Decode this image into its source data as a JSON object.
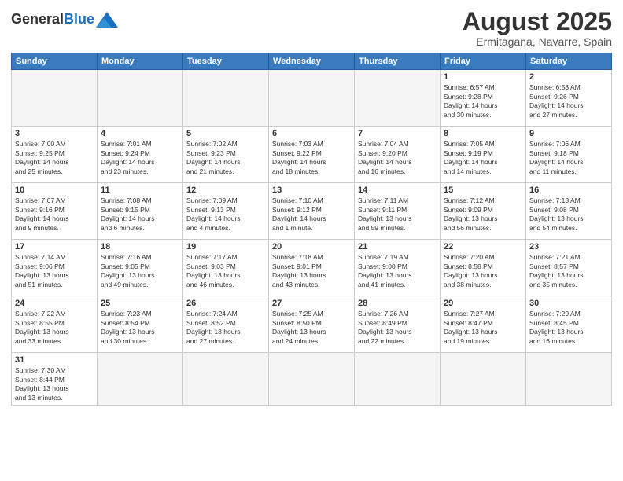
{
  "header": {
    "logo_general": "General",
    "logo_blue": "Blue",
    "title": "August 2025",
    "subtitle": "Ermitagana, Navarre, Spain"
  },
  "days_of_week": [
    "Sunday",
    "Monday",
    "Tuesday",
    "Wednesday",
    "Thursday",
    "Friday",
    "Saturday"
  ],
  "weeks": [
    [
      {
        "day": "",
        "info": ""
      },
      {
        "day": "",
        "info": ""
      },
      {
        "day": "",
        "info": ""
      },
      {
        "day": "",
        "info": ""
      },
      {
        "day": "",
        "info": ""
      },
      {
        "day": "1",
        "info": "Sunrise: 6:57 AM\nSunset: 9:28 PM\nDaylight: 14 hours\nand 30 minutes."
      },
      {
        "day": "2",
        "info": "Sunrise: 6:58 AM\nSunset: 9:26 PM\nDaylight: 14 hours\nand 27 minutes."
      }
    ],
    [
      {
        "day": "3",
        "info": "Sunrise: 7:00 AM\nSunset: 9:25 PM\nDaylight: 14 hours\nand 25 minutes."
      },
      {
        "day": "4",
        "info": "Sunrise: 7:01 AM\nSunset: 9:24 PM\nDaylight: 14 hours\nand 23 minutes."
      },
      {
        "day": "5",
        "info": "Sunrise: 7:02 AM\nSunset: 9:23 PM\nDaylight: 14 hours\nand 21 minutes."
      },
      {
        "day": "6",
        "info": "Sunrise: 7:03 AM\nSunset: 9:22 PM\nDaylight: 14 hours\nand 18 minutes."
      },
      {
        "day": "7",
        "info": "Sunrise: 7:04 AM\nSunset: 9:20 PM\nDaylight: 14 hours\nand 16 minutes."
      },
      {
        "day": "8",
        "info": "Sunrise: 7:05 AM\nSunset: 9:19 PM\nDaylight: 14 hours\nand 14 minutes."
      },
      {
        "day": "9",
        "info": "Sunrise: 7:06 AM\nSunset: 9:18 PM\nDaylight: 14 hours\nand 11 minutes."
      }
    ],
    [
      {
        "day": "10",
        "info": "Sunrise: 7:07 AM\nSunset: 9:16 PM\nDaylight: 14 hours\nand 9 minutes."
      },
      {
        "day": "11",
        "info": "Sunrise: 7:08 AM\nSunset: 9:15 PM\nDaylight: 14 hours\nand 6 minutes."
      },
      {
        "day": "12",
        "info": "Sunrise: 7:09 AM\nSunset: 9:13 PM\nDaylight: 14 hours\nand 4 minutes."
      },
      {
        "day": "13",
        "info": "Sunrise: 7:10 AM\nSunset: 9:12 PM\nDaylight: 14 hours\nand 1 minute."
      },
      {
        "day": "14",
        "info": "Sunrise: 7:11 AM\nSunset: 9:11 PM\nDaylight: 13 hours\nand 59 minutes."
      },
      {
        "day": "15",
        "info": "Sunrise: 7:12 AM\nSunset: 9:09 PM\nDaylight: 13 hours\nand 56 minutes."
      },
      {
        "day": "16",
        "info": "Sunrise: 7:13 AM\nSunset: 9:08 PM\nDaylight: 13 hours\nand 54 minutes."
      }
    ],
    [
      {
        "day": "17",
        "info": "Sunrise: 7:14 AM\nSunset: 9:06 PM\nDaylight: 13 hours\nand 51 minutes."
      },
      {
        "day": "18",
        "info": "Sunrise: 7:16 AM\nSunset: 9:05 PM\nDaylight: 13 hours\nand 49 minutes."
      },
      {
        "day": "19",
        "info": "Sunrise: 7:17 AM\nSunset: 9:03 PM\nDaylight: 13 hours\nand 46 minutes."
      },
      {
        "day": "20",
        "info": "Sunrise: 7:18 AM\nSunset: 9:01 PM\nDaylight: 13 hours\nand 43 minutes."
      },
      {
        "day": "21",
        "info": "Sunrise: 7:19 AM\nSunset: 9:00 PM\nDaylight: 13 hours\nand 41 minutes."
      },
      {
        "day": "22",
        "info": "Sunrise: 7:20 AM\nSunset: 8:58 PM\nDaylight: 13 hours\nand 38 minutes."
      },
      {
        "day": "23",
        "info": "Sunrise: 7:21 AM\nSunset: 8:57 PM\nDaylight: 13 hours\nand 35 minutes."
      }
    ],
    [
      {
        "day": "24",
        "info": "Sunrise: 7:22 AM\nSunset: 8:55 PM\nDaylight: 13 hours\nand 33 minutes."
      },
      {
        "day": "25",
        "info": "Sunrise: 7:23 AM\nSunset: 8:54 PM\nDaylight: 13 hours\nand 30 minutes."
      },
      {
        "day": "26",
        "info": "Sunrise: 7:24 AM\nSunset: 8:52 PM\nDaylight: 13 hours\nand 27 minutes."
      },
      {
        "day": "27",
        "info": "Sunrise: 7:25 AM\nSunset: 8:50 PM\nDaylight: 13 hours\nand 24 minutes."
      },
      {
        "day": "28",
        "info": "Sunrise: 7:26 AM\nSunset: 8:49 PM\nDaylight: 13 hours\nand 22 minutes."
      },
      {
        "day": "29",
        "info": "Sunrise: 7:27 AM\nSunset: 8:47 PM\nDaylight: 13 hours\nand 19 minutes."
      },
      {
        "day": "30",
        "info": "Sunrise: 7:29 AM\nSunset: 8:45 PM\nDaylight: 13 hours\nand 16 minutes."
      }
    ],
    [
      {
        "day": "31",
        "info": "Sunrise: 7:30 AM\nSunset: 8:44 PM\nDaylight: 13 hours\nand 13 minutes."
      },
      {
        "day": "",
        "info": ""
      },
      {
        "day": "",
        "info": ""
      },
      {
        "day": "",
        "info": ""
      },
      {
        "day": "",
        "info": ""
      },
      {
        "day": "",
        "info": ""
      },
      {
        "day": "",
        "info": ""
      }
    ]
  ]
}
